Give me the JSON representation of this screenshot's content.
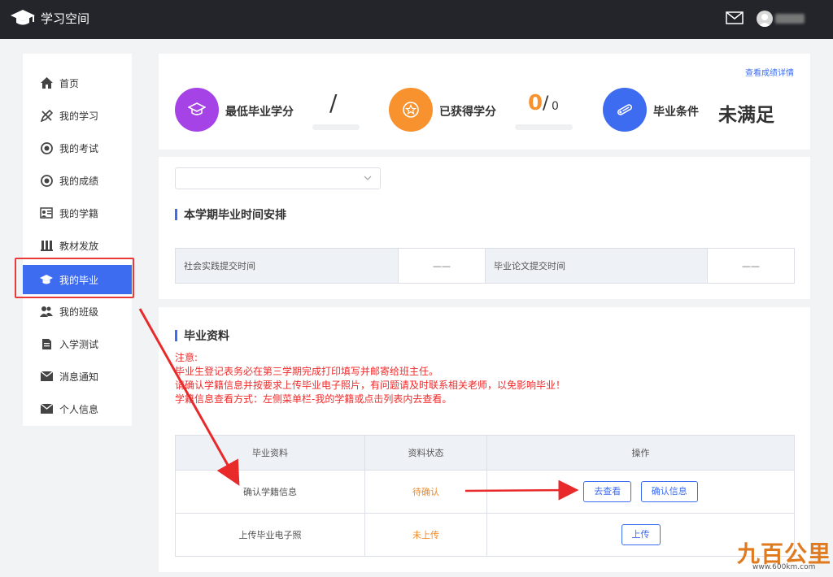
{
  "header": {
    "title": "学习空间"
  },
  "sidebar": {
    "items": [
      {
        "label": "首页",
        "icon": "home-icon"
      },
      {
        "label": "我的学习",
        "icon": "pencil-ruler-icon"
      },
      {
        "label": "我的考试",
        "icon": "medal-icon"
      },
      {
        "label": "我的成绩",
        "icon": "medal-icon"
      },
      {
        "label": "我的学籍",
        "icon": "id-card-icon"
      },
      {
        "label": "教材发放",
        "icon": "books-icon"
      },
      {
        "label": "我的毕业",
        "icon": "graduation-cap-icon",
        "active": true
      },
      {
        "label": "我的班级",
        "icon": "users-icon"
      },
      {
        "label": "入学测试",
        "icon": "document-icon"
      },
      {
        "label": "消息通知",
        "icon": "envelope-icon"
      },
      {
        "label": "个人信息",
        "icon": "envelope-icon"
      }
    ]
  },
  "summary": {
    "detail_link": "查看成绩详情",
    "min_credits_label": "最低毕业学分",
    "min_credits_value": "/",
    "earned_label": "已获得学分",
    "earned_value": "0",
    "earned_sep": "/",
    "earned_total": "0",
    "condition_label": "毕业条件",
    "condition_value": "未满足",
    "colors": {
      "purple": "#a543e6",
      "orange": "#f7922e",
      "blue": "#3d6cf0"
    }
  },
  "schedule": {
    "title": "本学期毕业时间安排",
    "practice_label": "社会实践提交时间",
    "practice_value": "——",
    "thesis_label": "毕业论文提交时间",
    "thesis_value": "——"
  },
  "materials": {
    "title": "毕业资料",
    "notice": [
      "注意:",
      "毕业生登记表务必在第三学期完成打印填写并邮寄给班主任。",
      "请确认学籍信息并按要求上传毕业电子照片，有问题请及时联系相关老师，以免影响毕业！",
      "学籍信息查看方式：左侧菜单栏-我的学籍或点击列表内去查看。"
    ],
    "columns": [
      "毕业资料",
      "资料状态",
      "操作"
    ],
    "rows": [
      {
        "name": "确认学籍信息",
        "status": "待确认",
        "buttons": [
          "去查看",
          "确认信息"
        ]
      },
      {
        "name": "上传毕业电子照",
        "status": "未上传",
        "buttons": [
          "上传"
        ]
      }
    ]
  },
  "watermark": {
    "text": "九百公里",
    "url": "www.600km.com"
  }
}
